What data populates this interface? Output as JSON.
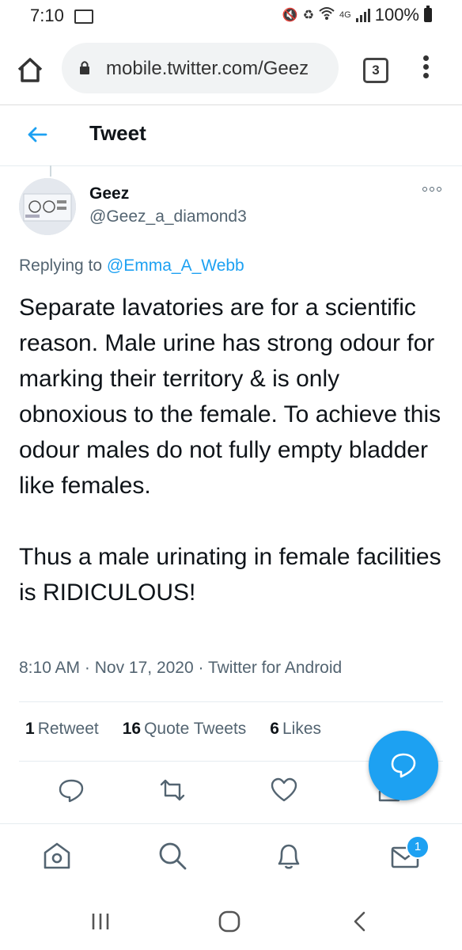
{
  "status_bar": {
    "time": "7:10",
    "network": "4G",
    "battery": "100%"
  },
  "browser": {
    "url": "mobile.twitter.com/Geez",
    "tab_count": "3"
  },
  "header": {
    "title": "Tweet"
  },
  "tweet": {
    "author_name": "Geez",
    "author_handle": "@Geez_a_diamond3",
    "replying_prefix": "Replying to ",
    "replying_to": "@Emma_A_Webb",
    "text_paragraph_1": "Separate lavatories are for a scientific reason. Male urine has strong odour for marking their territory & is only obnoxious to the female. To achieve this odour males do not fully empty bladder like females.",
    "text_paragraph_2": "Thus a male urinating in female facilities is RIDICULOUS!",
    "time": "8:10 AM",
    "date": "Nov 17, 2020",
    "source": "Twitter for Android",
    "separator": " · "
  },
  "stats": {
    "retweets_count": "1",
    "retweets_label": "Retweet",
    "quotes_count": "16",
    "quotes_label": "Quote Tweets",
    "likes_count": "6",
    "likes_label": "Likes"
  },
  "nav": {
    "messages_badge": "1"
  },
  "colors": {
    "accent": "#1da1f2",
    "text": "#0f1419",
    "muted": "#536471"
  }
}
